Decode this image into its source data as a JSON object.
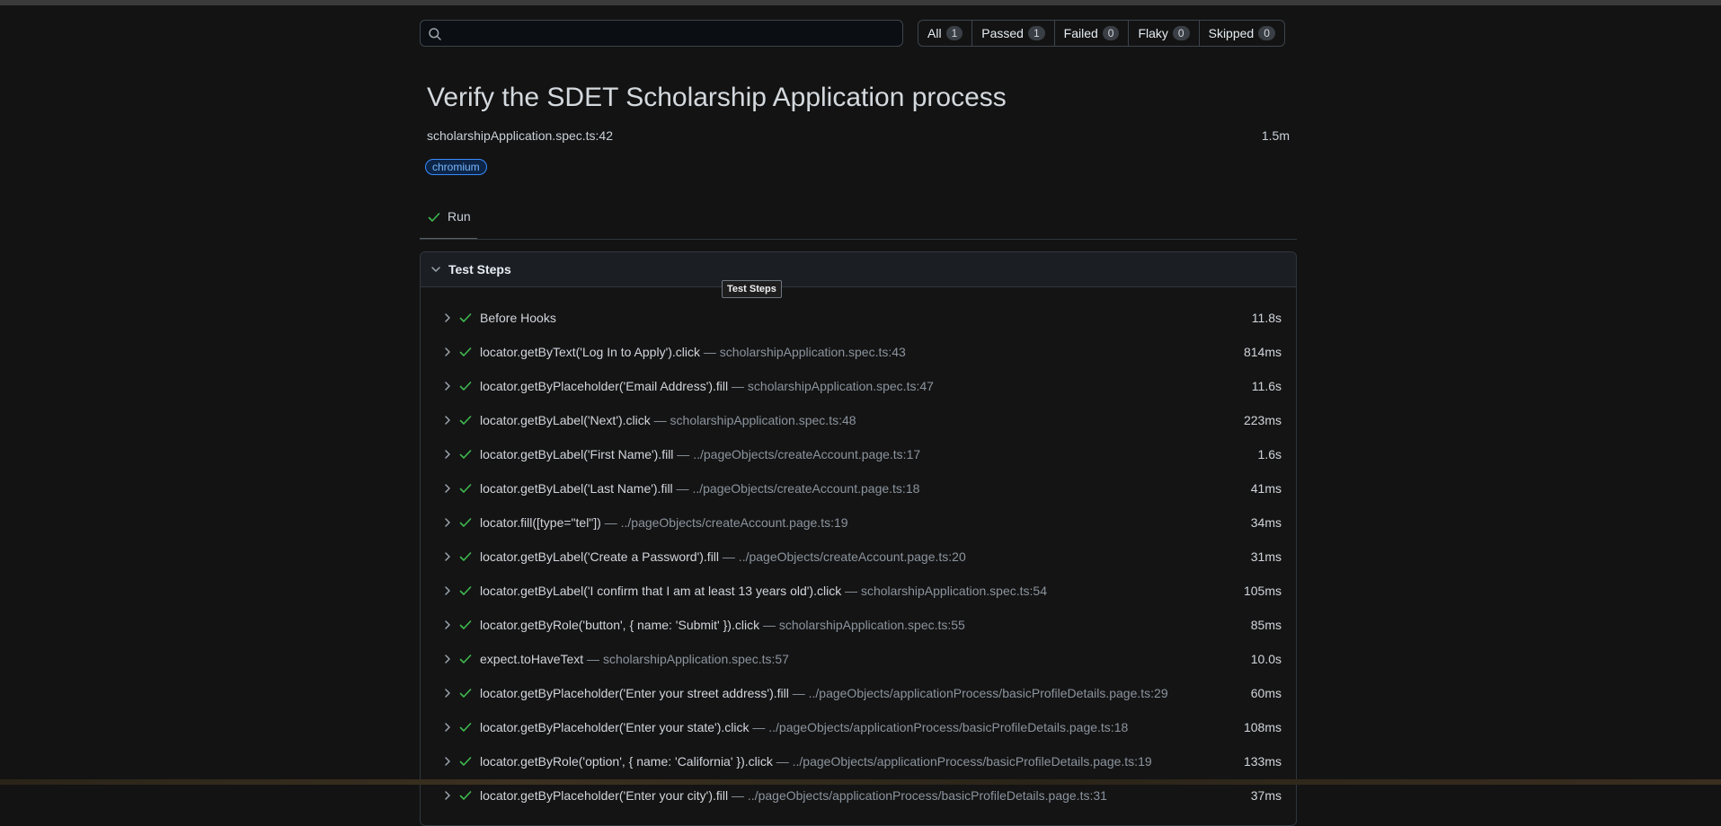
{
  "search": {
    "placeholder": "",
    "value": ""
  },
  "filters": [
    {
      "label": "All",
      "count": "1"
    },
    {
      "label": "Passed",
      "count": "1"
    },
    {
      "label": "Failed",
      "count": "0"
    },
    {
      "label": "Flaky",
      "count": "0"
    },
    {
      "label": "Skipped",
      "count": "0"
    }
  ],
  "test": {
    "title": "Verify the SDET Scholarship Application process",
    "location": "scholarshipApplication.spec.ts:42",
    "duration": "1.5m",
    "project": "chromium"
  },
  "run_tab": {
    "label": "Run"
  },
  "steps_panel": {
    "title": "Test Steps",
    "tooltip": "Test Steps",
    "steps": [
      {
        "action": "Before Hooks",
        "location": "",
        "duration": "11.8s"
      },
      {
        "action": "locator.getByText('Log In to Apply').click",
        "location": " — scholarshipApplication.spec.ts:43",
        "duration": "814ms"
      },
      {
        "action": "locator.getByPlaceholder('Email Address').fill",
        "location": " — scholarshipApplication.spec.ts:47",
        "duration": "11.6s"
      },
      {
        "action": "locator.getByLabel('Next').click",
        "location": " — scholarshipApplication.spec.ts:48",
        "duration": "223ms"
      },
      {
        "action": "locator.getByLabel('First Name').fill",
        "location": " — ../pageObjects/createAccount.page.ts:17",
        "duration": "1.6s"
      },
      {
        "action": "locator.getByLabel('Last Name').fill",
        "location": " — ../pageObjects/createAccount.page.ts:18",
        "duration": "41ms"
      },
      {
        "action": "locator.fill([type=\"tel\"])",
        "location": " — ../pageObjects/createAccount.page.ts:19",
        "duration": "34ms"
      },
      {
        "action": "locator.getByLabel('Create a Password').fill",
        "location": " — ../pageObjects/createAccount.page.ts:20",
        "duration": "31ms"
      },
      {
        "action": "locator.getByLabel('I confirm that I am at least 13 years old').click",
        "location": " — scholarshipApplication.spec.ts:54",
        "duration": "105ms"
      },
      {
        "action": "locator.getByRole('button', { name: 'Submit' }).click",
        "location": " — scholarshipApplication.spec.ts:55",
        "duration": "85ms"
      },
      {
        "action": "expect.toHaveText",
        "location": " — scholarshipApplication.spec.ts:57",
        "duration": "10.0s"
      },
      {
        "action": "locator.getByPlaceholder('Enter your street address').fill",
        "location": " — ../pageObjects/applicationProcess/basicProfileDetails.page.ts:29",
        "duration": "60ms"
      },
      {
        "action": "locator.getByPlaceholder('Enter your state').click",
        "location": " — ../pageObjects/applicationProcess/basicProfileDetails.page.ts:18",
        "duration": "108ms"
      },
      {
        "action": "locator.getByRole('option', { name: 'California' }).click",
        "location": " — ../pageObjects/applicationProcess/basicProfileDetails.page.ts:19",
        "duration": "133ms"
      },
      {
        "action": "locator.getByPlaceholder('Enter your city').fill",
        "location": " — ../pageObjects/applicationProcess/basicProfileDetails.page.ts:31",
        "duration": "37ms"
      }
    ]
  },
  "colors": {
    "background": "#131313",
    "pass_green": "#3fb950",
    "badge_blue": "#388bfd"
  },
  "icons": {
    "search": "search-icon",
    "step_expand": "chevron-right-icon",
    "panel_collapse": "chevron-down-icon",
    "status": "check-icon"
  }
}
